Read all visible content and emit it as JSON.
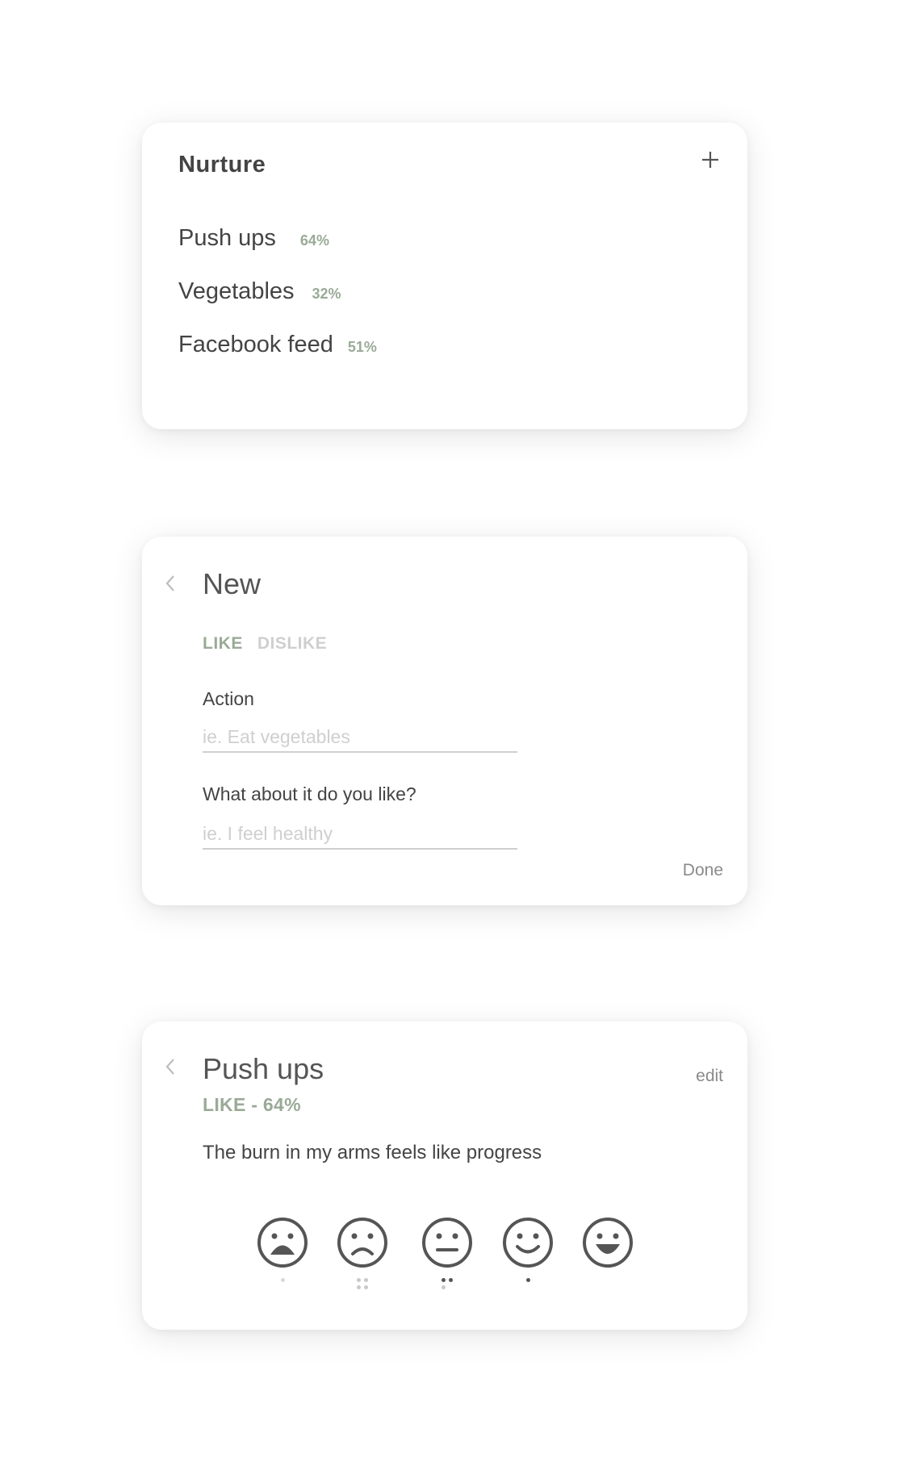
{
  "nurture_card": {
    "title": "Nurture",
    "add_icon": "plus-icon",
    "items": [
      {
        "label": "Push ups",
        "percent": "64%"
      },
      {
        "label": "Vegetables",
        "percent": "32%"
      },
      {
        "label": "Facebook feed",
        "percent": "51%"
      }
    ]
  },
  "new_card": {
    "back_icon": "chevron-left-icon",
    "title": "New",
    "tabs": {
      "like": "LIKE",
      "dislike": "DISLIKE",
      "selected": "LIKE"
    },
    "action_label": "Action",
    "action_placeholder": "ie. Eat vegetables",
    "reason_label": "What about it do you like?",
    "reason_placeholder": "ie. I feel healthy",
    "done_label": "Done"
  },
  "detail_card": {
    "back_icon": "chevron-left-icon",
    "title": "Push ups",
    "edit_label": "edit",
    "like_percent": "LIKE - 64%",
    "reason": "The burn in my arms feels like progress",
    "moods": [
      {
        "icon": "very-sad-face-icon",
        "dot_count": 1
      },
      {
        "icon": "sad-face-icon",
        "dot_count": 4
      },
      {
        "icon": "neutral-face-icon",
        "dot_count": 3
      },
      {
        "icon": "smile-face-icon",
        "dot_count": 1
      },
      {
        "icon": "grin-face-icon",
        "dot_count": 0
      }
    ]
  },
  "colors": {
    "accent_green": "#9aaa97",
    "text_dark": "#444444",
    "text_muted": "#8a8a8a",
    "placeholder": "#cfcfcf"
  }
}
